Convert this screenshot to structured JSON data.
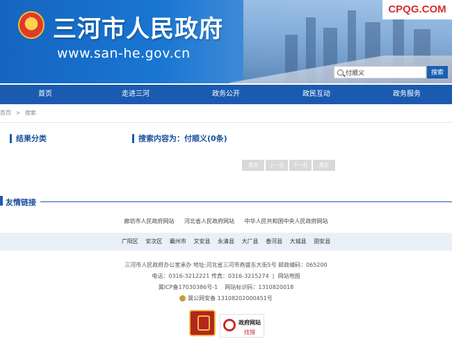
{
  "header": {
    "title": "三河市人民政府",
    "url": "www.san-he.gov.cn",
    "watermark": "CPQG.COM"
  },
  "search": {
    "value": "付顺义",
    "button": "搜索"
  },
  "nav": {
    "items": [
      "首页",
      "走进三河",
      "政务公开",
      "政民互动",
      "政务服务"
    ]
  },
  "breadcrumb": {
    "home": "首页",
    "sep": ">",
    "current": "搜索"
  },
  "results": {
    "category_title": "结果分类",
    "search_label": "搜索内容为：付顺义(0条)"
  },
  "pager": {
    "first": "首页",
    "prev": "上一页",
    "next": "下一页",
    "last": "尾页"
  },
  "friend_links": {
    "title": "友情链接",
    "links": [
      "廊坊市人民政府网站",
      "河北省人民政府网站",
      "中华人民共和国中央人民政府网站"
    ],
    "counties": [
      "广阳区",
      "安次区",
      "霸州市",
      "文安县",
      "永清县",
      "大厂县",
      "香河县",
      "大城县",
      "固安县"
    ]
  },
  "footer": {
    "line1": "三河市人民政府办公室承办 地址:河北省三河市燕盛东大街5号 邮政编码：065200",
    "phone": "电话：0316-3212221 传真：0316-3215274",
    "sitemap": "网站地图",
    "icp": "冀ICP备17030386号-1",
    "site_code": "网站标识码：1310820018",
    "police": "冀公网安备 13108202000451号",
    "badge2_title": "政府网站",
    "badge2_sub": "找错"
  },
  "colors": {
    "nav": "#1a5bb0",
    "accent": "#1a4f9c",
    "watermark": "#d32f2f"
  }
}
